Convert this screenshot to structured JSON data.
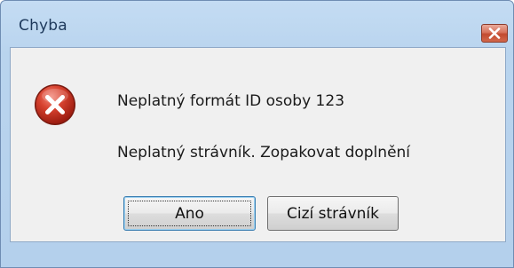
{
  "window": {
    "title": "Chyba"
  },
  "titlebar": {
    "close_icon": "close-icon"
  },
  "dialog": {
    "icon": "error-icon",
    "message_line1": "Neplatný formát ID osoby 123",
    "message_line2": "Neplatný strávník. Zopakovat doplnění"
  },
  "buttons": {
    "yes_label": "Ano",
    "foreign_diner_label": "Cizí strávník"
  },
  "colors": {
    "titlebar": "#c4dcf3",
    "client": "#f0f0f0",
    "close_button": "#c24a30",
    "error_icon": "#c42b1c"
  }
}
